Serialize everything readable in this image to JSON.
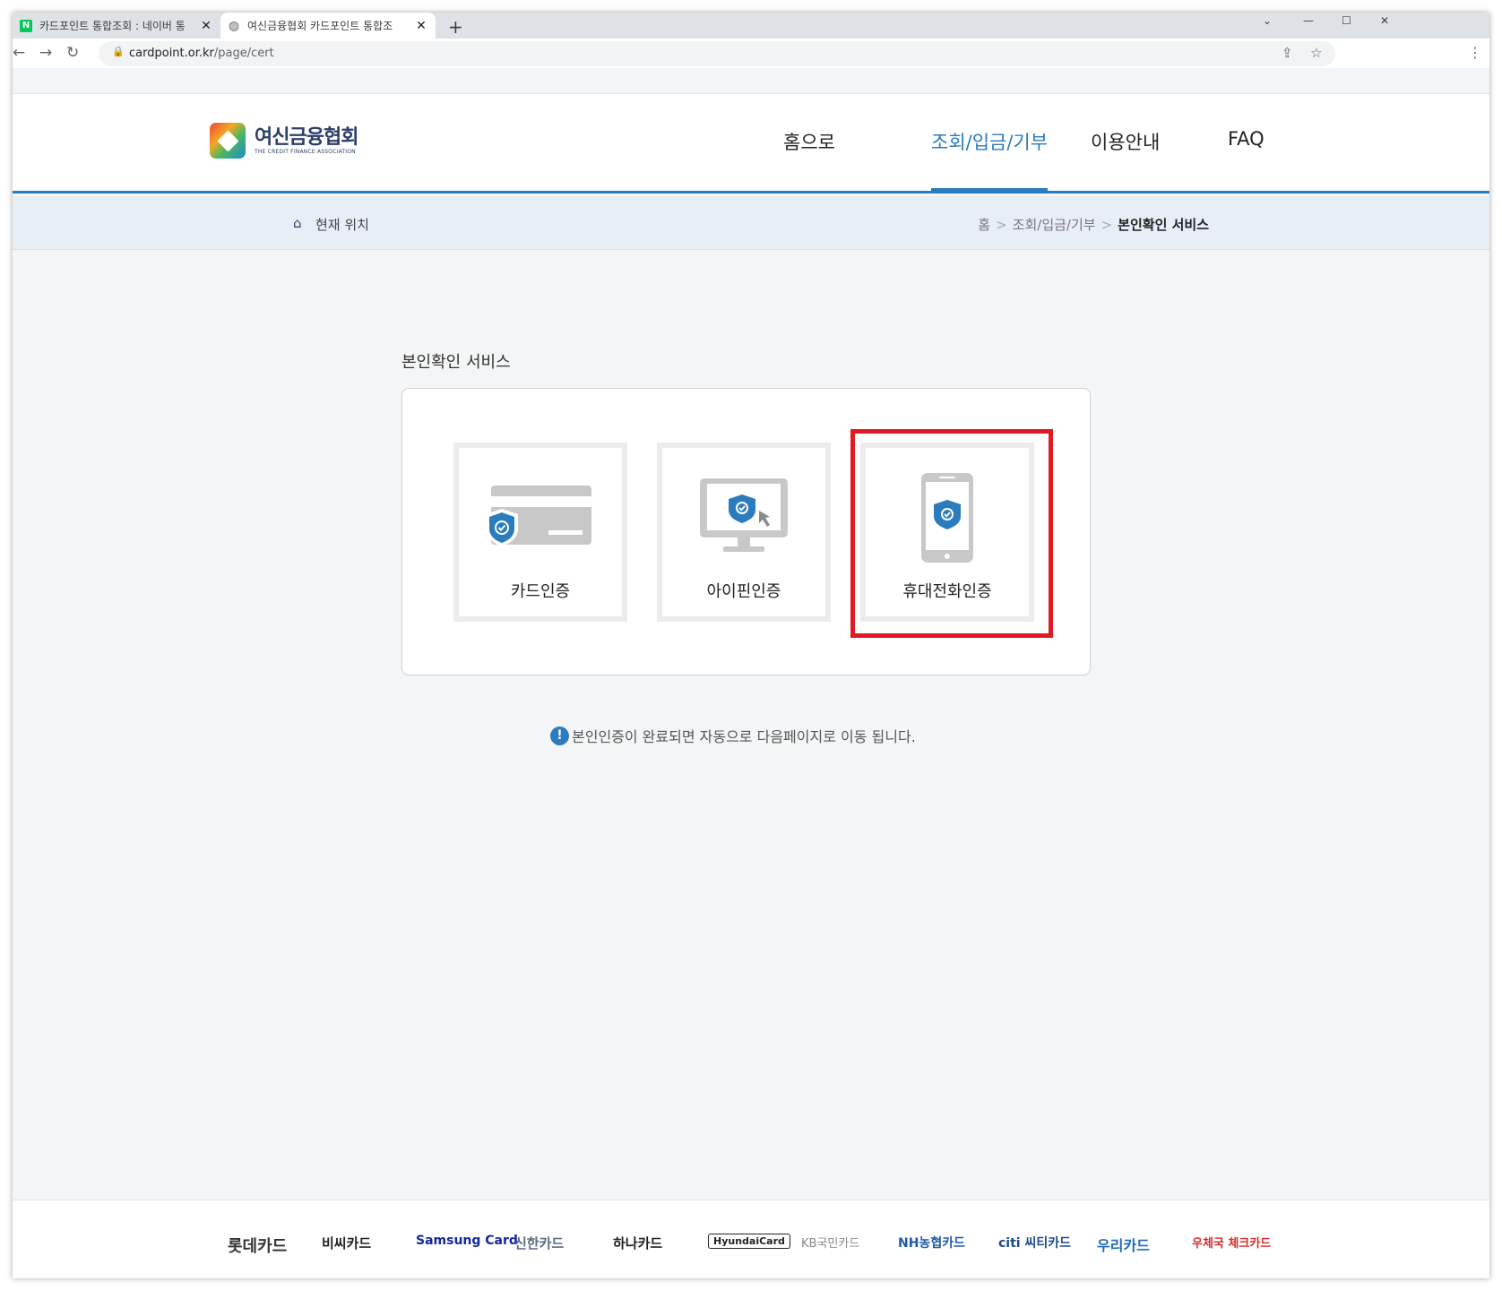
{
  "browser": {
    "tabs": [
      {
        "title": "카드포인트 통합조회 : 네이버 통",
        "favicon": "naver-favicon",
        "active": false
      },
      {
        "title": "여신금융협회 카드포인트 통합조",
        "favicon": "globe-favicon",
        "active": true
      }
    ],
    "url_host": "cardpoint.or.kr",
    "url_path": "/page/cert"
  },
  "header": {
    "logo_ko": "여신금융협회",
    "logo_en": "THE CREDIT FINANCE ASSOCIATION",
    "nav": [
      "홈으로",
      "조회/입금/기부",
      "이용안내",
      "FAQ"
    ],
    "active_nav": "조회/입금/기부"
  },
  "location": {
    "label": "현재 위치",
    "crumbs": [
      "홈",
      "조회/입금/기부",
      "본인확인 서비스"
    ]
  },
  "main": {
    "title": "본인확인 서비스",
    "options": [
      {
        "label": "카드인증",
        "icon": "card-shield-icon"
      },
      {
        "label": "아이핀인증",
        "icon": "monitor-shield-icon"
      },
      {
        "label": "휴대전화인증",
        "icon": "phone-shield-icon"
      }
    ],
    "notice": "본인인증이 완료되면 자동으로 다음페이지로 이동 됩니다."
  },
  "colors": {
    "accent": "#2b7bbf",
    "highlight": "#e01b24",
    "icon_gray": "#c8c8c8"
  },
  "footer": {
    "brands": [
      {
        "name": "롯데카드",
        "color": "#333333"
      },
      {
        "name": "비씨카드",
        "color": "#222222"
      },
      {
        "name": "Samsung Card",
        "color": "#1428a0"
      },
      {
        "name": "신한카드",
        "color": "#5a6a85"
      },
      {
        "name": "하나카드",
        "color": "#222222"
      },
      {
        "name": "HyundaiCard",
        "color": "#222222"
      },
      {
        "name": "KB국민카드",
        "color": "#8a8a8a"
      },
      {
        "name": "NH농협카드",
        "color": "#1e5aa8"
      },
      {
        "name": "citi 씨티카드",
        "color": "#1e4a8a"
      },
      {
        "name": "우리카드",
        "color": "#1e6ab8"
      },
      {
        "name": "우체국 체크카드",
        "color": "#d42b2b"
      }
    ]
  }
}
